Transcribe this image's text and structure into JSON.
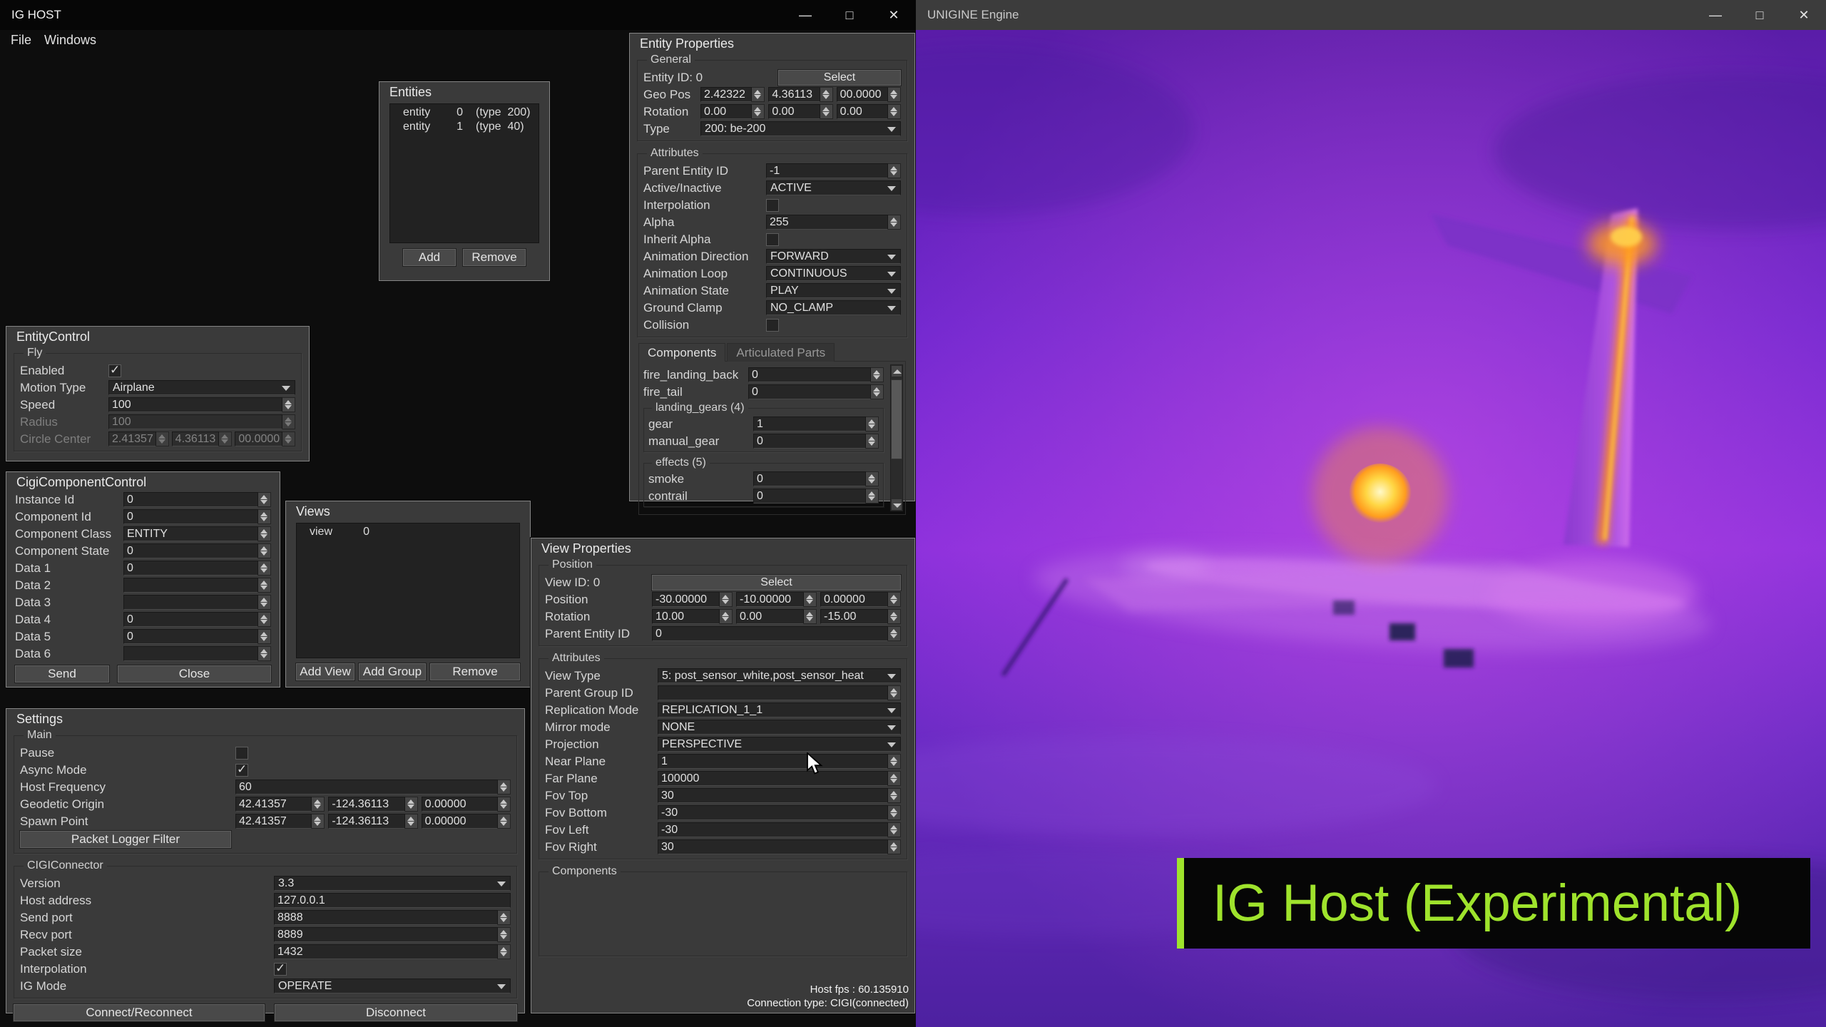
{
  "ig_host": {
    "window_title": "IG HOST",
    "menu": {
      "file": "File",
      "windows": "Windows"
    },
    "window_controls": {
      "minimize": "—",
      "maximize": "□",
      "close": "✕"
    },
    "entities": {
      "title": "Entities",
      "items": [
        {
          "name": "entity",
          "id": "0",
          "type": "(type  200)"
        },
        {
          "name": "entity",
          "id": "1",
          "type": "(type  40)"
        }
      ],
      "add_label": "Add",
      "remove_label": "Remove"
    },
    "entity_properties": {
      "title": "Entity Properties",
      "general": {
        "legend": "General",
        "entity_id_label": "Entity ID: 0",
        "select_label": "Select",
        "geo_pos_label": "Geo Pos",
        "geo_pos": [
          "2.42322",
          "4.36113",
          "00.0000"
        ],
        "rotation_label": "Rotation",
        "rotation": [
          "0.00",
          "0.00",
          "0.00"
        ],
        "type_label": "Type",
        "type_value": "200: be-200"
      },
      "attributes": {
        "legend": "Attributes",
        "parent_entity_id": {
          "label": "Parent Entity ID",
          "value": "-1"
        },
        "active_inactive": {
          "label": "Active/Inactive",
          "value": "ACTIVE"
        },
        "interpolation": {
          "label": "Interpolation",
          "checked": false
        },
        "alpha": {
          "label": "Alpha",
          "value": "255"
        },
        "inherit_alpha": {
          "label": "Inherit Alpha",
          "checked": false
        },
        "animation_direction": {
          "label": "Animation Direction",
          "value": "FORWARD"
        },
        "animation_loop": {
          "label": "Animation Loop",
          "value": "CONTINUOUS"
        },
        "animation_state": {
          "label": "Animation State",
          "value": "PLAY"
        },
        "ground_clamp": {
          "label": "Ground Clamp",
          "value": "NO_CLAMP"
        },
        "collision": {
          "label": "Collision",
          "checked": false
        }
      },
      "tabs": {
        "components": "Components",
        "articulated_parts": "Articulated Parts"
      },
      "components": {
        "fire_landing_back": {
          "label": "fire_landing_back",
          "value": "0"
        },
        "fire_tail": {
          "label": "fire_tail",
          "value": "0"
        },
        "landing_gears": {
          "legend": "landing_gears (4)",
          "gear": {
            "label": "gear",
            "value": "1"
          },
          "manual_gear": {
            "label": "manual_gear",
            "value": "0"
          }
        },
        "effects": {
          "legend": "effects (5)",
          "smoke": {
            "label": "smoke",
            "value": "0"
          },
          "contrail": {
            "label": "contrail",
            "value": "0"
          }
        }
      }
    },
    "entity_control": {
      "title": "EntityControl",
      "fly_legend": "Fly",
      "enabled": {
        "label": "Enabled",
        "checked": true
      },
      "motion_type": {
        "label": "Motion Type",
        "value": "Airplane"
      },
      "speed": {
        "label": "Speed",
        "value": "100"
      },
      "radius": {
        "label": "Radius",
        "value": "100"
      },
      "circle_center": {
        "label": "Circle Center",
        "values": [
          "2.41357",
          "4.36113",
          "00.0000"
        ]
      }
    },
    "cigi_component_control": {
      "title": "CigiComponentControl",
      "instance_id": {
        "label": "Instance Id",
        "value": "0"
      },
      "component_id": {
        "label": "Component Id",
        "value": "0"
      },
      "component_class": {
        "label": "Component Class",
        "value": "ENTITY"
      },
      "component_state": {
        "label": "Component State",
        "value": "0"
      },
      "data_1": {
        "label": "Data 1",
        "value": "0"
      },
      "data_2": {
        "label": "Data 2",
        "value": ""
      },
      "data_3": {
        "label": "Data 3",
        "value": ""
      },
      "data_4": {
        "label": "Data 4",
        "value": "0"
      },
      "data_5": {
        "label": "Data 5",
        "value": "0"
      },
      "data_6": {
        "label": "Data 6",
        "value": ""
      },
      "send_label": "Send",
      "close_label": "Close"
    },
    "views": {
      "title": "Views",
      "items": [
        {
          "name": "view",
          "id": "0"
        }
      ],
      "add_view_label": "Add View",
      "add_group_label": "Add Group",
      "remove_label": "Remove"
    },
    "settings": {
      "title": "Settings",
      "main": {
        "legend": "Main",
        "pause": {
          "label": "Pause",
          "checked": false
        },
        "async_mode": {
          "label": "Async Mode",
          "checked": true
        },
        "host_frequency": {
          "label": "Host Frequency",
          "value": "60"
        },
        "geodetic_origin": {
          "label": "Geodetic Origin",
          "values": [
            "42.41357",
            "-124.36113",
            "0.00000"
          ]
        },
        "spawn_point": {
          "label": "Spawn Point",
          "values": [
            "42.41357",
            "-124.36113",
            "0.00000"
          ]
        },
        "packet_logger_filter_label": "Packet Logger Filter"
      },
      "cigi_connector": {
        "legend": "CIGIConnector",
        "version": {
          "label": "Version",
          "value": "3.3"
        },
        "host_address": {
          "label": "Host address",
          "value": "127.0.0.1"
        },
        "send_port": {
          "label": "Send port",
          "value": "8888"
        },
        "recv_port": {
          "label": "Recv port",
          "value": "8889"
        },
        "packet_size": {
          "label": "Packet size",
          "value": "1432"
        },
        "interpolation": {
          "label": "Interpolation",
          "checked": true
        },
        "ig_mode": {
          "label": "IG Mode",
          "value": "OPERATE"
        }
      },
      "connect_label": "Connect/Reconnect",
      "disconnect_label": "Disconnect"
    },
    "view_properties": {
      "title": "View Properties",
      "position": {
        "legend": "Position",
        "view_id_label": "View ID: 0",
        "select_label": "Select",
        "position": {
          "label": "Position",
          "values": [
            "-30.00000",
            "-10.00000",
            "0.00000"
          ]
        },
        "rotation": {
          "label": "Rotation",
          "values": [
            "10.00",
            "0.00",
            "-15.00"
          ]
        },
        "parent_entity_id": {
          "label": "Parent Entity ID",
          "value": "0"
        }
      },
      "attributes": {
        "legend": "Attributes",
        "view_type": {
          "label": "View Type",
          "value": "5: post_sensor_white,post_sensor_heat"
        },
        "parent_group_id": {
          "label": "Parent Group ID",
          "value": ""
        },
        "replication_mode": {
          "label": "Replication Mode",
          "value": "REPLICATION_1_1"
        },
        "mirror_mode": {
          "label": "Mirror mode",
          "value": "NONE"
        },
        "projection": {
          "label": "Projection",
          "value": "PERSPECTIVE"
        },
        "near_plane": {
          "label": "Near Plane",
          "value": "1"
        },
        "far_plane": {
          "label": "Far Plane",
          "value": "100000"
        },
        "fov_top": {
          "label": "Fov Top",
          "value": "30"
        },
        "fov_bottom": {
          "label": "Fov Bottom",
          "value": "-30"
        },
        "fov_left": {
          "label": "Fov Left",
          "value": "-30"
        },
        "fov_right": {
          "label": "Fov Right",
          "value": "30"
        }
      },
      "components_legend": "Components"
    },
    "status": {
      "host_fps": "Host fps : 60.135910",
      "connection_type": "Connection type: CIGI(connected)"
    }
  },
  "unigine": {
    "window_title": "UNIGINE Engine",
    "window_controls": {
      "minimize": "—",
      "maximize": "□",
      "close": "✕"
    },
    "caption": {
      "text": "IG Host (Experimental)",
      "text_color": "#9fe32c",
      "bar_color": "#9fe32c",
      "background": "#060606"
    },
    "thermal_palette": {
      "sky_top": "#5a1da8",
      "sky_mid": "#8c30dc",
      "sky_bottom": "#4d21a0",
      "hot": "#ff9d1e",
      "hot_core": "#fff9c8"
    }
  }
}
